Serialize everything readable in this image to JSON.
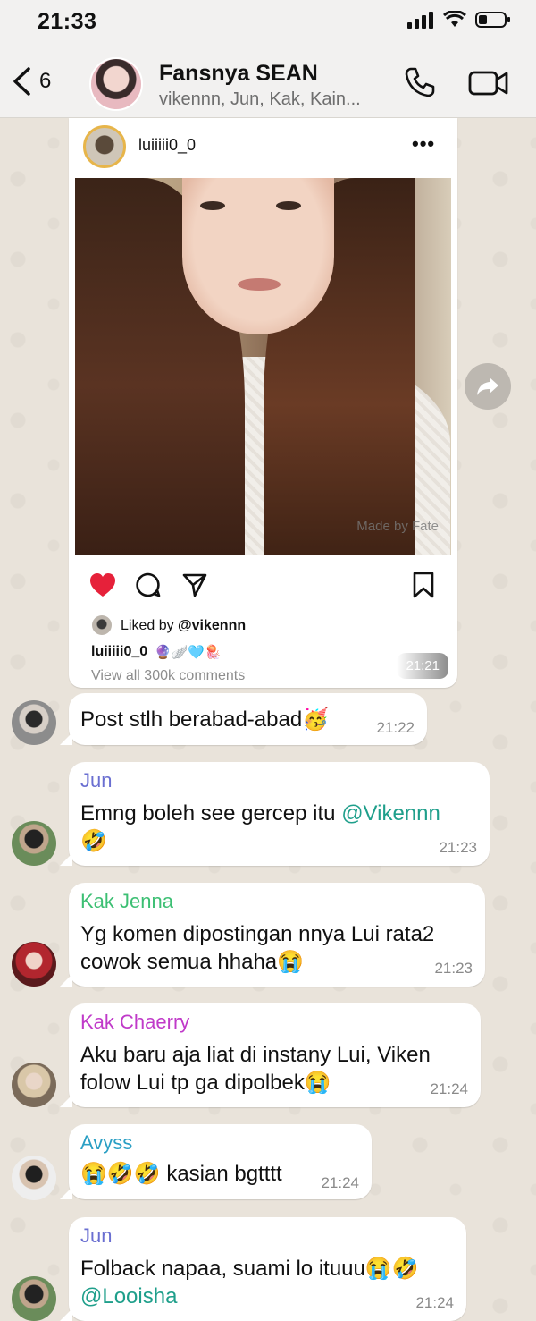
{
  "status_bar": {
    "time": "21:33"
  },
  "header": {
    "back_count": "6",
    "title": "Fansnya SEAN",
    "members": "vikennn, Jun, Kak, Kain..."
  },
  "post": {
    "username": "luiiiii0_0",
    "more": "•••",
    "watermark": "Made by Fate",
    "liked_by_prefix": "Liked by ",
    "liked_by_user": "@vikennn",
    "caption_user": "luiiiii0_0",
    "caption_emoji": "🔮🪽🩵🪼",
    "view_comments": "View all 300k comments",
    "time": "21:21"
  },
  "messages": [
    {
      "sender": "",
      "text": "Post stlh berabad-abad🥳",
      "time": "21:22"
    },
    {
      "sender": "Jun",
      "sender_color": "#6a6fd1",
      "text_before": "Emng boleh see gercep itu ",
      "mention": "@Vikennn",
      "text_after": "🤣",
      "time": "21:23"
    },
    {
      "sender": "Kak Jenna",
      "sender_color": "#3cbf73",
      "line1": "Yg komen dipostingan nnya Lui rata2",
      "line2": "cowok semua hhaha😭",
      "time": "21:23"
    },
    {
      "sender": "Kak Chaerry",
      "sender_color": "#c03ac9",
      "line1": "Aku baru aja liat di instany Lui, Viken",
      "line2": "folow Lui tp ga dipolbek😭",
      "time": "21:24"
    },
    {
      "sender": "Avyss",
      "sender_color": "#2a9fc4",
      "text": "😭🤣🤣 kasian bgtttt",
      "time": "21:24"
    },
    {
      "sender": "Jun",
      "sender_color": "#6a6fd1",
      "line1": "Folback napaa, suami lo ituuu😭🤣",
      "mention": "@Looisha",
      "time": "21:24"
    }
  ]
}
